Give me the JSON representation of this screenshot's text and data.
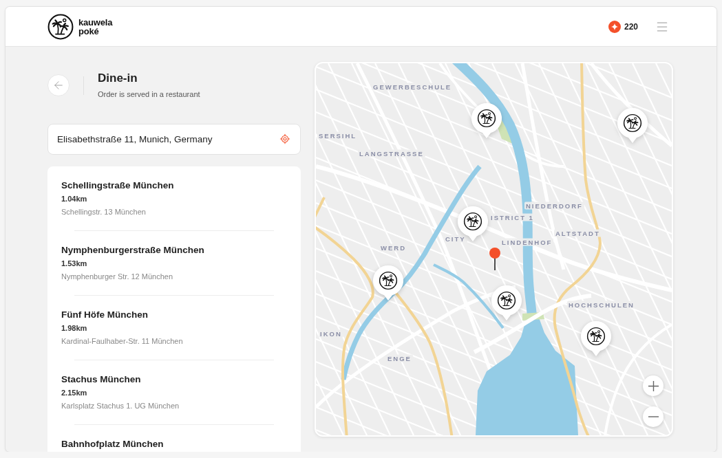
{
  "header": {
    "brand": "kauwela poké",
    "points": "220"
  },
  "page": {
    "title": "Dine-in",
    "subtitle": "Order is served in a restaurant"
  },
  "address_field": {
    "value": "Elisabethstraße 11, Munich, Germany"
  },
  "restaurants": [
    {
      "name": "Schellingstraße München",
      "distance": "1.04km",
      "address": "Schellingstr. 13 München"
    },
    {
      "name": "Nymphenburgerstraße München",
      "distance": "1.53km",
      "address": "Nymphenburger Str. 12 München"
    },
    {
      "name": "Fünf Höfe München",
      "distance": "1.98km",
      "address": "Kardinal-Faulhaber-Str. 11 München"
    },
    {
      "name": "Stachus München",
      "distance": "2.15km",
      "address": "Karlsplatz Stachus 1. UG München"
    },
    {
      "name": "Bahnhofplatz München"
    }
  ],
  "map": {
    "labels": [
      "GEWERBESCHULE",
      "SERSIHL",
      "LANGSTRASSE",
      "NIEDERDORF",
      "ISTRICT 1",
      "CITY",
      "WERD",
      "LINDENHOF",
      "ALTSTADT",
      "HOCHSCHULEN",
      "IKON",
      "ENGE"
    ]
  }
}
